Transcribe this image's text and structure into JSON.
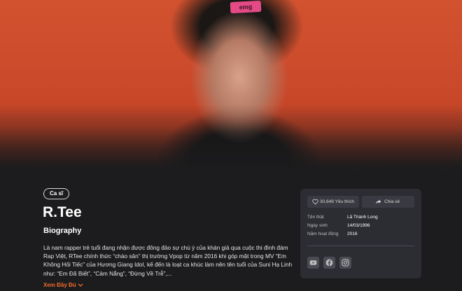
{
  "hero": {
    "cap_text": "emg",
    "colors": {
      "background": "#c9482a",
      "page": "#1c1c1e"
    }
  },
  "artist": {
    "badge": "Ca sĩ",
    "name": "R.Tee",
    "bio_heading": "Biography",
    "bio": "Là nam rapper trẻ tuổi đang nhận được đông đảo sự chú ý của khán giả qua cuộc thi đình đám Rap Việt, RTee chính thức “chào sân” thị trường Vpop từ năm 2016 khi góp mặt trong MV “Em Không Hối Tiếc” của Hương Giang Idol, kế đến là loạt ca khúc làm nên tên tuổi của Suni Hạ Linh như: “Em Đã Biết”, “Cảm Nắng”, “Đừng Về Trễ”,...",
    "read_more": "Xem Đầy Đủ",
    "read_more_color": "#f06a2a"
  },
  "card": {
    "like_label": "30,649 Yêu thích",
    "share_label": "Chia sẻ",
    "info": [
      {
        "key": "Tên thật",
        "value": "Lã Thành Long"
      },
      {
        "key": "Ngày sinh",
        "value": "14/03/1996"
      },
      {
        "key": "Năm hoạt động",
        "value": "2016"
      }
    ],
    "socials": [
      "youtube-icon",
      "facebook-icon",
      "instagram-icon"
    ]
  }
}
